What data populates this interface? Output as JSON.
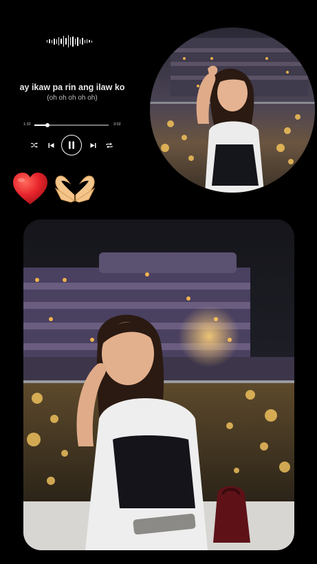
{
  "player": {
    "lyric_line": "ay ikaw pa rin ang ilaw ko",
    "lyric_sub": "(oh oh oh oh oh)",
    "time_elapsed": "1:32",
    "time_total": "3:02",
    "progress_fraction": 0.18,
    "icons": {
      "waveform": "audio-waveform-icon",
      "shuffle": "shuffle-icon",
      "previous": "skip-previous-icon",
      "play_pause": "pause-icon",
      "next": "skip-next-icon",
      "repeat": "repeat-icon"
    }
  },
  "stickers": [
    "red-heart-emoji",
    "heart-hands-emoji"
  ],
  "colors": {
    "background": "#000000",
    "text": "#ffffff",
    "heart": "#e8242b",
    "skin": "#f4c58a"
  },
  "photos": {
    "circle_photo": "photo",
    "main_photo": "photo"
  }
}
